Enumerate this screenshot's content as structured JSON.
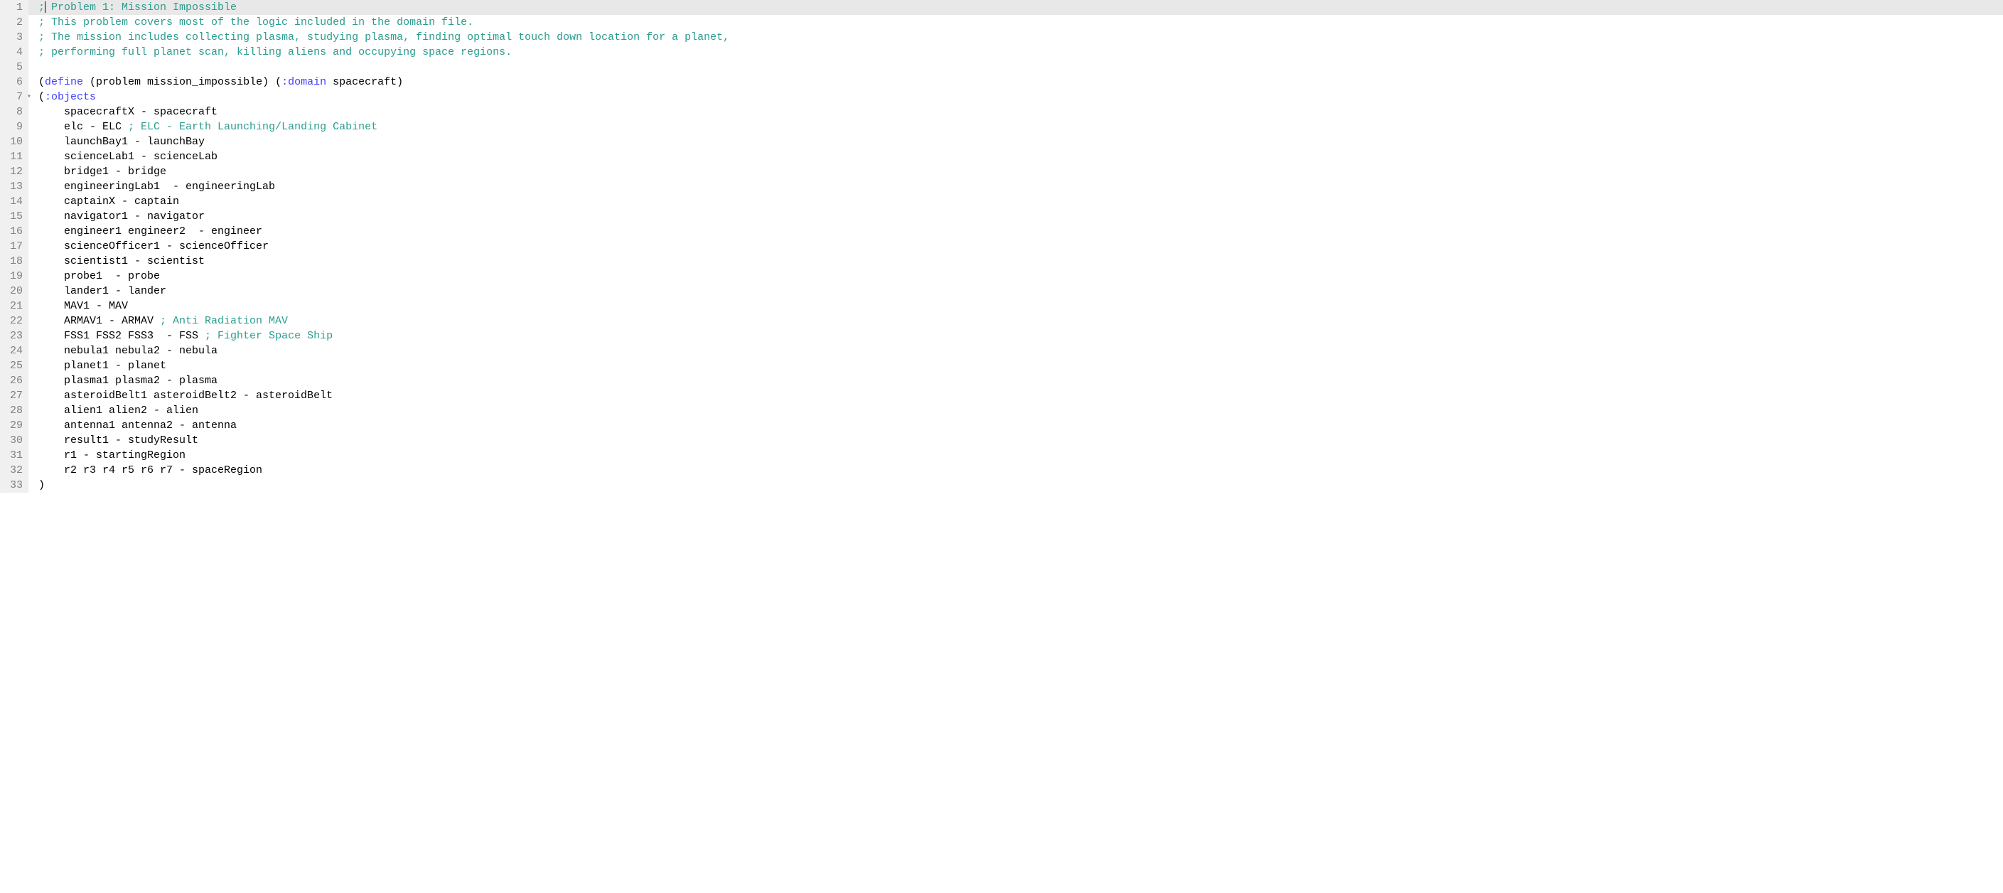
{
  "lines": [
    {
      "n": 1,
      "active": true,
      "segments": [
        {
          "t": ";",
          "c": "comment"
        },
        {
          "t": "|",
          "c": "cursor"
        },
        {
          "t": " Problem 1: Mission Impossible",
          "c": "comment"
        }
      ]
    },
    {
      "n": 2,
      "segments": [
        {
          "t": "; This problem covers most of the logic included in the domain file.",
          "c": "comment"
        }
      ]
    },
    {
      "n": 3,
      "segments": [
        {
          "t": "; The mission includes collecting plasma, studying plasma, finding optimal touch down location for a planet,",
          "c": "comment"
        }
      ]
    },
    {
      "n": 4,
      "segments": [
        {
          "t": "; performing full planet scan, killing aliens and occupying space regions.",
          "c": "comment"
        }
      ]
    },
    {
      "n": 5,
      "segments": [
        {
          "t": "",
          "c": "plain"
        }
      ]
    },
    {
      "n": 6,
      "segments": [
        {
          "t": "(",
          "c": "plain"
        },
        {
          "t": "define",
          "c": "keyword"
        },
        {
          "t": " (problem mission_impossible) (",
          "c": "plain"
        },
        {
          "t": ":domain",
          "c": "keyword"
        },
        {
          "t": " spacecraft)",
          "c": "plain"
        }
      ]
    },
    {
      "n": 7,
      "fold": true,
      "segments": [
        {
          "t": "(",
          "c": "plain"
        },
        {
          "t": ":objects",
          "c": "keyword"
        }
      ]
    },
    {
      "n": 8,
      "segments": [
        {
          "t": "    spacecraftX - spacecraft",
          "c": "plain"
        }
      ]
    },
    {
      "n": 9,
      "segments": [
        {
          "t": "    elc - ELC ",
          "c": "plain"
        },
        {
          "t": "; ELC - Earth Launching/Landing Cabinet",
          "c": "comment"
        }
      ]
    },
    {
      "n": 10,
      "segments": [
        {
          "t": "    launchBay1 - launchBay",
          "c": "plain"
        }
      ]
    },
    {
      "n": 11,
      "segments": [
        {
          "t": "    scienceLab1 - scienceLab",
          "c": "plain"
        }
      ]
    },
    {
      "n": 12,
      "segments": [
        {
          "t": "    bridge1 - bridge",
          "c": "plain"
        }
      ]
    },
    {
      "n": 13,
      "segments": [
        {
          "t": "    engineeringLab1  - engineeringLab",
          "c": "plain"
        }
      ]
    },
    {
      "n": 14,
      "segments": [
        {
          "t": "    captainX - captain",
          "c": "plain"
        }
      ]
    },
    {
      "n": 15,
      "segments": [
        {
          "t": "    navigator1 - navigator",
          "c": "plain"
        }
      ]
    },
    {
      "n": 16,
      "segments": [
        {
          "t": "    engineer1 engineer2  - engineer",
          "c": "plain"
        }
      ]
    },
    {
      "n": 17,
      "segments": [
        {
          "t": "    scienceOfficer1 - scienceOfficer",
          "c": "plain"
        }
      ]
    },
    {
      "n": 18,
      "segments": [
        {
          "t": "    scientist1 - scientist",
          "c": "plain"
        }
      ]
    },
    {
      "n": 19,
      "segments": [
        {
          "t": "    probe1  - probe",
          "c": "plain"
        }
      ]
    },
    {
      "n": 20,
      "segments": [
        {
          "t": "    lander1 - lander",
          "c": "plain"
        }
      ]
    },
    {
      "n": 21,
      "segments": [
        {
          "t": "    MAV1 - MAV",
          "c": "plain"
        }
      ]
    },
    {
      "n": 22,
      "segments": [
        {
          "t": "    ARMAV1 - ARMAV ",
          "c": "plain"
        },
        {
          "t": "; Anti Radiation MAV",
          "c": "comment"
        }
      ]
    },
    {
      "n": 23,
      "segments": [
        {
          "t": "    FSS1 FSS2 FSS3  - FSS ",
          "c": "plain"
        },
        {
          "t": "; Fighter Space Ship",
          "c": "comment"
        }
      ]
    },
    {
      "n": 24,
      "segments": [
        {
          "t": "    nebula1 nebula2 - nebula",
          "c": "plain"
        }
      ]
    },
    {
      "n": 25,
      "segments": [
        {
          "t": "    planet1 - planet",
          "c": "plain"
        }
      ]
    },
    {
      "n": 26,
      "segments": [
        {
          "t": "    plasma1 plasma2 - plasma",
          "c": "plain"
        }
      ]
    },
    {
      "n": 27,
      "segments": [
        {
          "t": "    asteroidBelt1 asteroidBelt2 - asteroidBelt",
          "c": "plain"
        }
      ]
    },
    {
      "n": 28,
      "segments": [
        {
          "t": "    alien1 alien2 - alien",
          "c": "plain"
        }
      ]
    },
    {
      "n": 29,
      "segments": [
        {
          "t": "    antenna1 antenna2 - antenna",
          "c": "plain"
        }
      ]
    },
    {
      "n": 30,
      "segments": [
        {
          "t": "    result1 - studyResult",
          "c": "plain"
        }
      ]
    },
    {
      "n": 31,
      "segments": [
        {
          "t": "    r1 - startingRegion",
          "c": "plain"
        }
      ]
    },
    {
      "n": 32,
      "segments": [
        {
          "t": "    r2 r3 r4 r5 r6 r7 - spaceRegion",
          "c": "plain"
        }
      ]
    },
    {
      "n": 33,
      "segments": [
        {
          "t": ")",
          "c": "plain"
        }
      ]
    }
  ]
}
